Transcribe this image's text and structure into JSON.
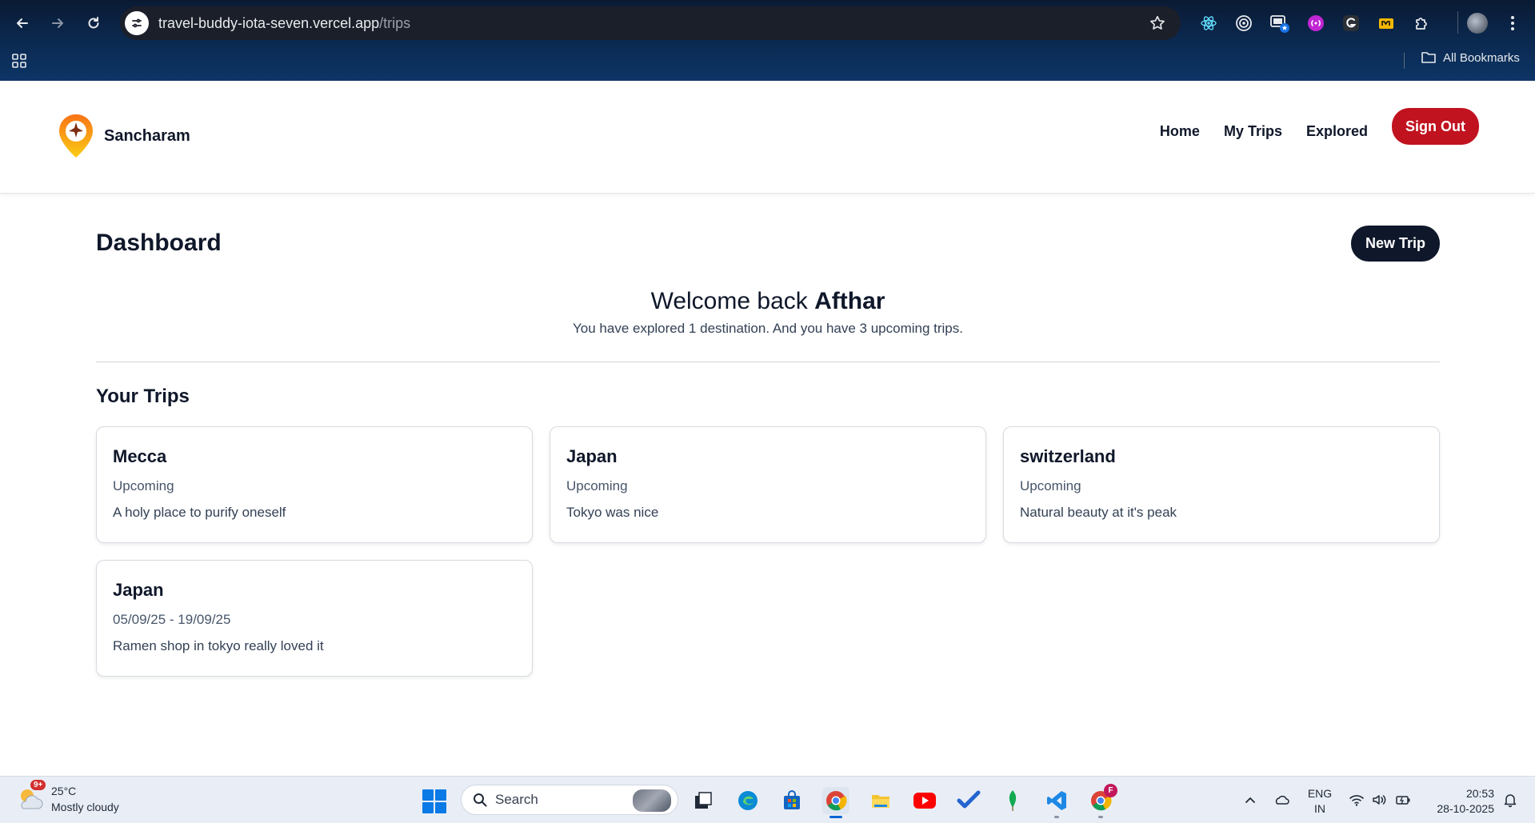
{
  "browser": {
    "url_host": "travel-buddy-iota-seven.vercel.app",
    "url_path": "/trips",
    "bookmarks_label": "All Bookmarks",
    "icons": [
      "back-icon",
      "forward-icon",
      "reload-icon",
      "site-info-icon",
      "star-icon",
      "react-devtools-icon",
      "target-icon",
      "screen-share-icon",
      "extension-purple-icon",
      "grammarly-icon",
      "extension-yellow-icon",
      "puzzle-icon",
      "profile-avatar",
      "menu-kebab-icon",
      "apps-grid-icon",
      "folder-icon"
    ]
  },
  "app": {
    "brand": "Sancharam",
    "nav": {
      "home": "Home",
      "my_trips": "My Trips",
      "explored": "Explored",
      "sign_out": "Sign Out"
    },
    "colors": {
      "sign_out": "#c1121f",
      "primary_dark": "#0f172a",
      "logo_orange": "#f59e0b"
    }
  },
  "dashboard": {
    "title": "Dashboard",
    "new_trip": "New Trip",
    "welcome_prefix": "Welcome back",
    "user_name": "Afthar",
    "summary": "You have explored 1 destination. And you have 3 upcoming trips.",
    "trips_heading": "Your Trips",
    "trips": [
      {
        "title": "Mecca",
        "status": "Upcoming",
        "description": "A holy place to purify oneself"
      },
      {
        "title": "Japan",
        "status": "Upcoming",
        "description": "Tokyo was nice"
      },
      {
        "title": "switzerland",
        "status": "Upcoming",
        "description": "Natural beauty at it's peak"
      },
      {
        "title": "Japan",
        "status": "05/09/25 - 19/09/25",
        "description": "Ramen shop in tokyo really loved it"
      }
    ]
  },
  "taskbar": {
    "weather_badge": "9+",
    "temperature": "25°C",
    "condition": "Mostly cloudy",
    "search_placeholder": "Search",
    "lang_top": "ENG",
    "lang_bottom": "IN",
    "time": "20:53",
    "date": "28-10-2025",
    "chrome_profile_badge": "F"
  }
}
